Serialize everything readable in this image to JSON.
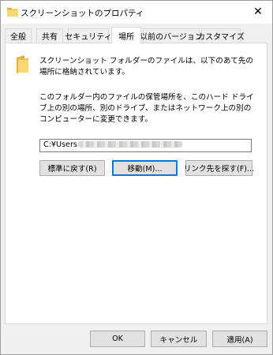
{
  "window": {
    "title": "スクリーンショットのプロパティ",
    "close_glyph": "✕"
  },
  "tabs": [
    {
      "label": "全般"
    },
    {
      "label": "共有"
    },
    {
      "label": "セキュリティ"
    },
    {
      "label": "場所"
    },
    {
      "label": "以前のバージョン"
    },
    {
      "label": "カスタマイズ"
    }
  ],
  "active_tab": "場所",
  "location": {
    "description_1": "スクリーンショット フォルダーのファイルは、以下のあて先の場所に格納されています。",
    "description_2": "このフォルダー内のファイルの保管場所を、このハード ドライブ上の別の場所、別のドライブ、またはネットワーク上の別のコンピューターに変更できます。",
    "path_value": "C:¥Users",
    "buttons": {
      "restore": "標準に戻す(R)",
      "move": "移動(M)...",
      "find_target": "リンク先を探す(F)..."
    }
  },
  "footer": {
    "ok": "OK",
    "cancel": "キャンセル",
    "apply": "適用(A)"
  },
  "colors": {
    "focus_accent": "#0078d7",
    "folder_yellow": "#f8d775"
  },
  "icons": {
    "title": "folder-icon",
    "panel": "folder-icon"
  }
}
